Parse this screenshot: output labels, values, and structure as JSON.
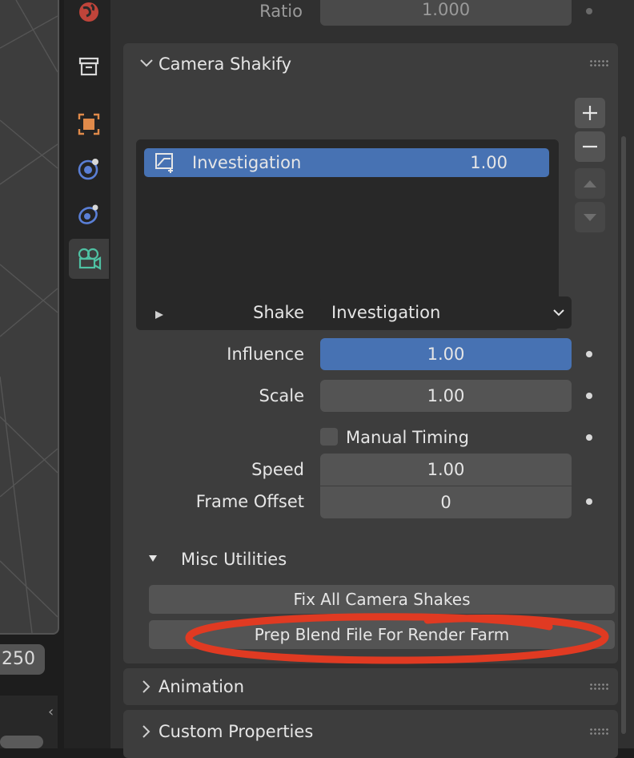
{
  "camera_top": {
    "ratio_label": "Ratio",
    "ratio_value": "1.000"
  },
  "shakify": {
    "title": "Camera Shakify",
    "list": {
      "items": [
        {
          "name": "Investigation",
          "value": "1.00"
        }
      ]
    },
    "shake_label": "Shake",
    "shake_value": "Investigation",
    "influence_label": "Influence",
    "influence_value": "1.00",
    "scale_label": "Scale",
    "scale_value": "1.00",
    "manual_timing_label": "Manual Timing",
    "speed_label": "Speed",
    "speed_value": "1.00",
    "frame_offset_label": "Frame Offset",
    "frame_offset_value": "0"
  },
  "misc": {
    "title": "Misc Utilities",
    "fix_button": "Fix All Camera Shakes",
    "prep_button": "Prep Blend File For Render Farm"
  },
  "panels": {
    "animation": "Animation",
    "custom_properties": "Custom Properties"
  },
  "timeline": {
    "frame_end": "250"
  },
  "colors": {
    "accent_blue": "#4772b3",
    "annotation_red": "#e03a22",
    "panel_bg": "#3d3d3d",
    "field_bg": "#545454"
  }
}
